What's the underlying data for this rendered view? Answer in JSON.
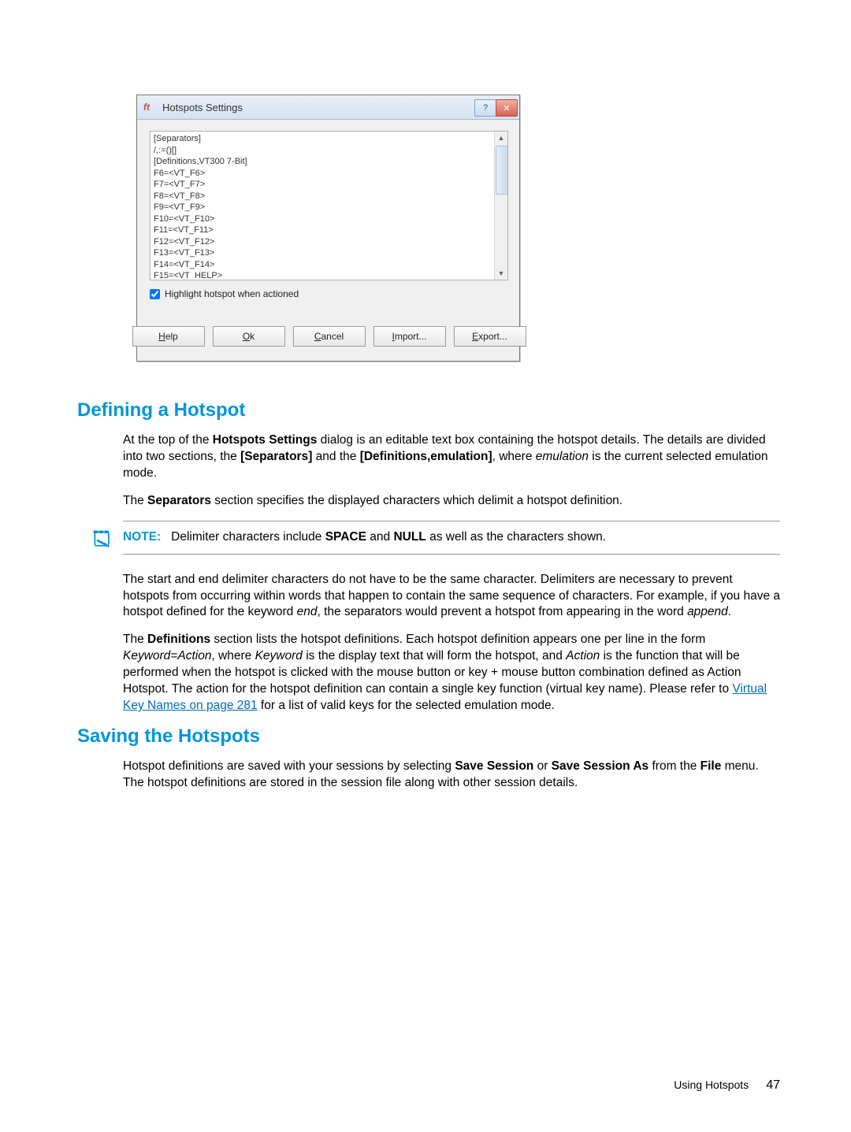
{
  "dialog": {
    "title": "Hotspots Settings",
    "definitions_text": "[Separators]\n/,:=()[]\n[Definitions,VT300 7-Bit]\nF6=<VT_F6>\nF7=<VT_F7>\nF8=<VT_F8>\nF9=<VT_F9>\nF10=<VT_F10>\nF11=<VT_F11>\nF12=<VT_F12>\nF13=<VT_F13>\nF14=<VT_F14>\nF15=<VT_HELP>",
    "hidden_bottom_hint": "",
    "checkbox_label": "Highlight hotspot when actioned",
    "buttons": {
      "help": "Help",
      "ok": "Ok",
      "cancel": "Cancel",
      "import": "Import...",
      "export": "Export..."
    }
  },
  "sections": {
    "defining_heading": "Defining a Hotspot",
    "saving_heading": "Saving the Hotspots"
  },
  "body": {
    "p1_a": "At the top of the ",
    "p1_b": "Hotspots Settings",
    "p1_c": " dialog is an editable text box containing the hotspot details. The details are divided into two sections, the ",
    "p1_d": "[Separators]",
    "p1_e": " and the ",
    "p1_f": "[Definitions,emulation]",
    "p1_g": ", where ",
    "p1_h": "emulation",
    "p1_i": " is the current selected emulation mode.",
    "p2_a": "The ",
    "p2_b": "Separators",
    "p2_c": " section specifies the displayed characters which delimit a hotspot definition.",
    "note_label": "NOTE:",
    "note_a": "Delimiter characters include ",
    "note_b": "SPACE",
    "note_c": " and ",
    "note_d": "NULL",
    "note_e": " as well as the characters shown.",
    "p3_a": "The start and end delimiter characters do not have to be the same character. Delimiters are necessary to prevent hotspots from occurring within words that happen to contain the same sequence of characters. For example, if you have a hotspot defined for the keyword ",
    "p3_b": "end",
    "p3_c": ", the separators would prevent a hotspot from appearing in the word ",
    "p3_d": "append",
    "p3_e": ".",
    "p4_a": "The ",
    "p4_b": "Definitions",
    "p4_c": " section lists the hotspot definitions. Each hotspot definition appears one per line in the form ",
    "p4_d": "Keyword=Action",
    "p4_e": ", where ",
    "p4_f": "Keyword",
    "p4_g": " is the display text that will form the hotspot, and ",
    "p4_h": "Action",
    "p4_i": " is the function that will be performed when the hotspot is clicked with the mouse button or key + mouse button combination defined as Action Hotspot. The action for the hotspot definition can contain a single key function (virtual key name). Please refer to ",
    "p4_link": "Virtual Key Names on page 281",
    "p4_j": " for a list of valid keys for the selected emulation mode.",
    "p5_a": "Hotspot definitions are saved with your sessions by selecting ",
    "p5_b": "Save Session",
    "p5_c": " or ",
    "p5_d": "Save Session As",
    "p5_e": " from the ",
    "p5_f": "File",
    "p5_g": " menu. The hotspot definitions are stored in the session file along with other session details."
  },
  "footer": {
    "label": "Using Hotspots",
    "page": "47"
  }
}
